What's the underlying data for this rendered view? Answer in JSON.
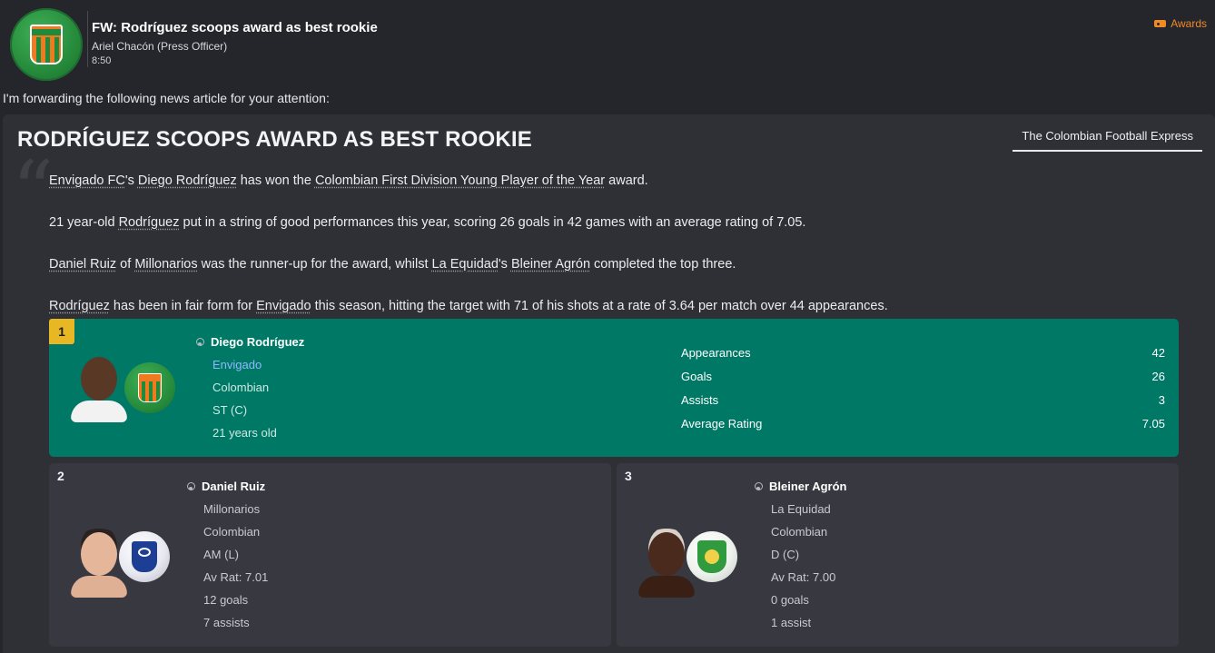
{
  "message": {
    "subject": "FW: Rodríguez scoops award as best rookie",
    "sender": "Ariel Chacón  (Press Officer)",
    "time": "8:50",
    "tag": "Awards",
    "sender_icon": "envigado-crest-icon",
    "forward_text": "I'm forwarding the following news article for your attention:"
  },
  "article": {
    "headline": "RODRÍGUEZ SCOOPS AWARD AS BEST ROOKIE",
    "source": "The Colombian Football Express",
    "p1": {
      "a": "Envigado FC",
      "b": "'s ",
      "c": "Diego Rodríguez",
      "d": " has won the ",
      "e": "Colombian First Division Young Player of the Year",
      "f": " award."
    },
    "p2": {
      "a": "21 year-old ",
      "b": "Rodríguez",
      "c": " put in a string of good performances this year, scoring 26 goals in 42 games with an average rating of 7.05."
    },
    "p3": {
      "a": "Daniel Ruiz",
      "b": " of ",
      "c": "Millonarios",
      "d": " was the runner-up for the award, whilst ",
      "e": "La Equidad",
      "f": "'s ",
      "g": "Bleiner Agrón",
      "h": " completed the top three."
    },
    "p4": {
      "a": "Rodríguez",
      "b": " has been in fair form for ",
      "c": "Envigado",
      "d": " this season, hitting the target with 71 of his shots at a rate of 3.64 per match over 44 appearances."
    }
  },
  "winner": {
    "rank": "1",
    "name": "Diego Rodríguez",
    "club": "Envigado",
    "nationality": "Colombian",
    "position": "ST (C)",
    "age": "21 years old",
    "stats": [
      {
        "label": "Appearances",
        "value": "42"
      },
      {
        "label": "Goals",
        "value": "26"
      },
      {
        "label": "Assists",
        "value": "3"
      },
      {
        "label": "Average Rating",
        "value": "7.05"
      }
    ],
    "accent": "#007866",
    "rank_color": "#e8b824"
  },
  "runners": [
    {
      "rank": "2",
      "name": "Daniel Ruiz",
      "club": "Millonarios",
      "nationality": "Colombian",
      "position": "AM (L)",
      "rating": "Av Rat: 7.01",
      "goals": "12 goals",
      "assists": "7 assists"
    },
    {
      "rank": "3",
      "name": "Bleiner Agrón",
      "club": "La Equidad",
      "nationality": "Colombian",
      "position": "D (C)",
      "rating": "Av Rat: 7.00",
      "goals": "0 goals",
      "assists": "1 assist"
    }
  ]
}
